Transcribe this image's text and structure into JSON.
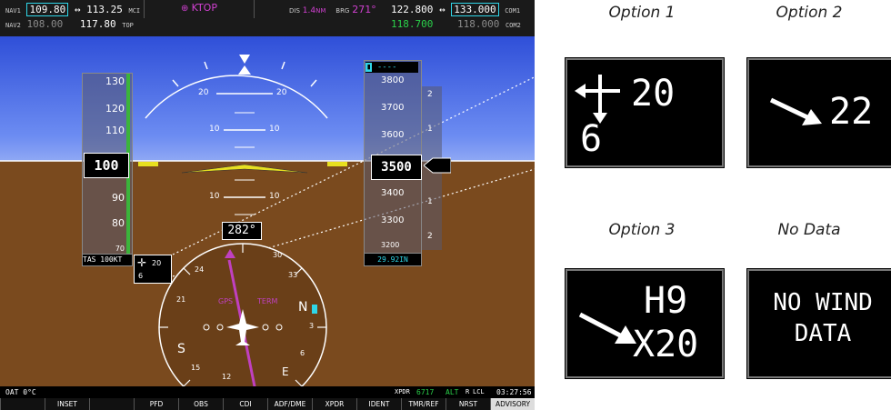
{
  "pfd": {
    "nav1_label": "NAV1",
    "nav1_active": "109.80",
    "nav1_standby": "113.25",
    "nav1_id": "MCI",
    "nav2_label": "NAV2",
    "nav2_active": "108.00",
    "nav2_standby": "117.80",
    "nav2_id": "TOP",
    "waypoint": "KTOP",
    "dis_label": "DIS",
    "dis_value": "1.4",
    "dis_unit": "NM",
    "brg_label": "BRG",
    "brg_value": "271°",
    "com1_active": "122.800",
    "com1_standby": "133.000",
    "com1_label": "COM1",
    "com2_active": "118.700",
    "com2_standby": "118.000",
    "com2_label": "COM2",
    "pitch_labels": [
      "20",
      "20",
      "10",
      "10",
      "10",
      "10"
    ],
    "airspeed_ticks": [
      "130",
      "120",
      "110",
      "90",
      "80",
      "70"
    ],
    "airspeed_current": "100",
    "tas": "TAS 100KT",
    "altitude_ticks": [
      "3800",
      "3700",
      "3600",
      "3400",
      "3300",
      "3200"
    ],
    "altitude_current": "3500",
    "selected_altitude": "----",
    "baro": "29.92IN",
    "vsi_ticks": [
      "2",
      "1",
      "1",
      "2"
    ],
    "heading": "282°",
    "compass": {
      "gps_label": "GPS",
      "term_label": "TERM",
      "cardinals": [
        "N",
        "S",
        "E",
        "W"
      ],
      "numbers": [
        "30",
        "33",
        "24",
        "21",
        "15",
        "12",
        "6",
        "3"
      ]
    },
    "wind_inset_speed": "20",
    "wind_inset_dir": "6",
    "oat": "OAT  0°C",
    "xpdr": "XPDR",
    "squawk": "6717",
    "xpdr_mode": "ALT",
    "lcl": "LCL",
    "time": "03:27:56",
    "softkeys": [
      "",
      "INSET",
      "",
      "PFD",
      "OBS",
      "CDI",
      "ADF/DME",
      "XPDR",
      "IDENT",
      "TMR/REF",
      "NRST",
      "ADVISORY"
    ]
  },
  "options": [
    {
      "label": "Option 1",
      "line1": "20",
      "line2": "6"
    },
    {
      "label": "Option 2",
      "line1": "22"
    },
    {
      "label": "Option 3",
      "line1": "H9",
      "line2": "X20"
    },
    {
      "label": "No Data",
      "line1": "NO WIND",
      "line2": "DATA"
    }
  ],
  "colors": {
    "sky": "#2f4fd8",
    "ground": "#7a4a1e",
    "cyan": "#2fd6e8",
    "green": "#2ad04a",
    "magenta": "#d040d0"
  }
}
